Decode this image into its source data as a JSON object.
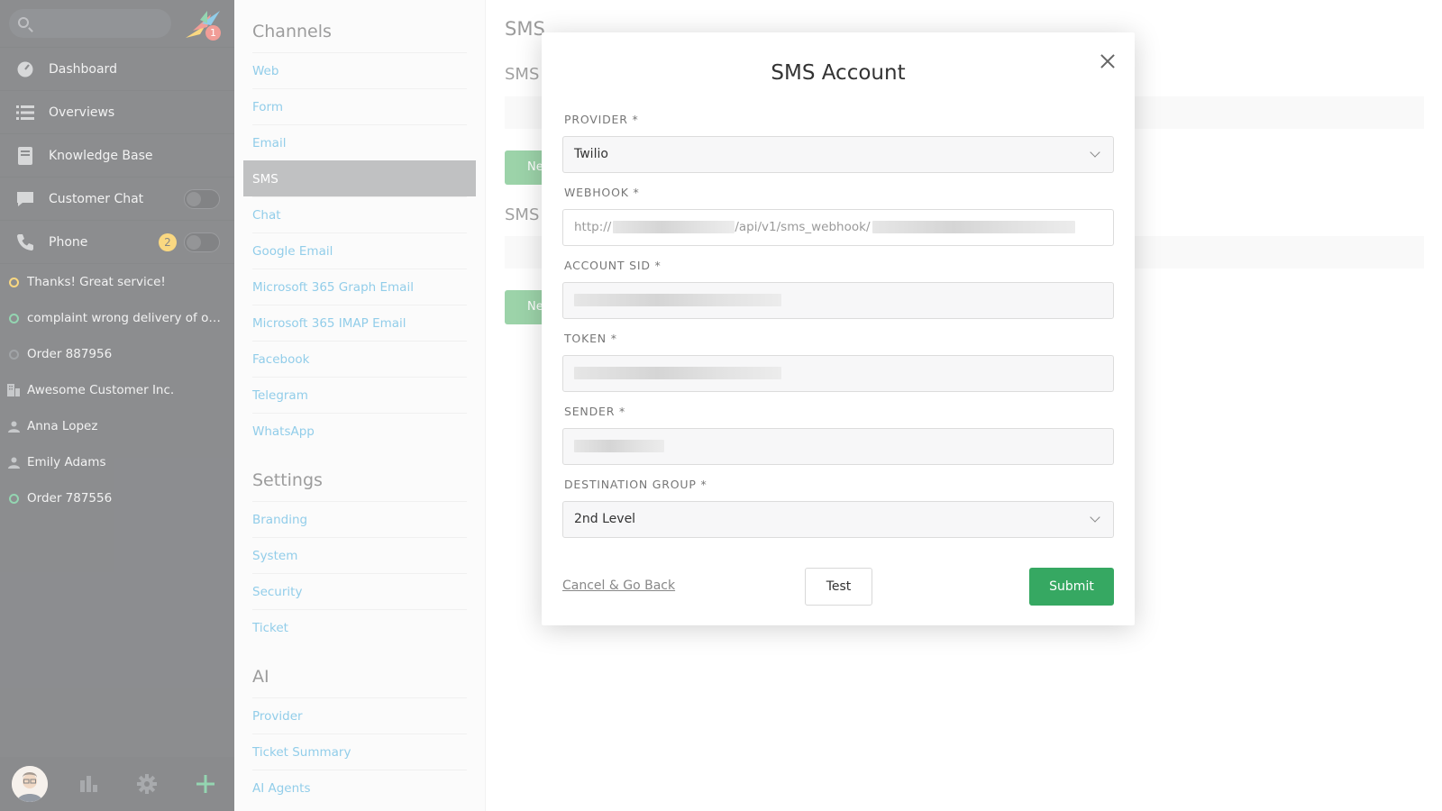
{
  "nav": {
    "notification_count": "1",
    "menu": [
      {
        "label": "Dashboard",
        "icon": "dashboard-icon"
      },
      {
        "label": "Overviews",
        "icon": "list-icon"
      },
      {
        "label": "Knowledge Base",
        "icon": "book-icon"
      },
      {
        "label": "Customer Chat",
        "icon": "chat-icon"
      },
      {
        "label": "Phone",
        "icon": "phone-icon",
        "badge": "2"
      }
    ],
    "tasks": [
      {
        "label": "Thanks! Great service!",
        "type": "ticket",
        "status_color": "#f6b91b"
      },
      {
        "label": "complaint wrong delivery of ord...",
        "type": "ticket",
        "status_color": "#3cb371"
      },
      {
        "label": "Order 887956",
        "type": "ticket",
        "status_color": "#555a60"
      },
      {
        "label": "Awesome Customer Inc.",
        "type": "organization"
      },
      {
        "label": "Anna Lopez",
        "type": "user"
      },
      {
        "label": "Emily Adams",
        "type": "user"
      },
      {
        "label": "Order 787556",
        "type": "ticket",
        "status_color": "#3cb371"
      }
    ]
  },
  "settings": {
    "channels_title": "Channels",
    "channels": [
      "Web",
      "Form",
      "Email",
      "SMS",
      "Chat",
      "Google Email",
      "Microsoft 365 Graph Email",
      "Microsoft 365 IMAP Email",
      "Facebook",
      "Telegram",
      "WhatsApp"
    ],
    "active_channel": "SMS",
    "settings_title": "Settings",
    "settings_items": [
      "Branding",
      "System",
      "Security",
      "Ticket"
    ],
    "ai_title": "AI",
    "ai_items": [
      "Provider",
      "Ticket Summary",
      "AI Agents"
    ]
  },
  "main": {
    "title": "SMS",
    "sub1": "SMS",
    "sub2": "SMS",
    "btn1": "Ne",
    "btn2": "Ne"
  },
  "modal": {
    "title": "SMS Account",
    "provider_label": "PROVIDER *",
    "provider_value": "Twilio",
    "webhook_label": "WEBHOOK *",
    "webhook_prefix": "http://",
    "webhook_mid": "/api/v1/sms_webhook/",
    "account_sid_label": "ACCOUNT SID *",
    "token_label": "TOKEN *",
    "sender_label": "SENDER *",
    "destination_group_label": "DESTINATION GROUP *",
    "destination_group_value": "2nd Level",
    "cancel_label": "Cancel & Go Back",
    "test_label": "Test",
    "submit_label": "Submit"
  },
  "colors": {
    "nav_bg": "#2e3034",
    "link": "#38a4d8",
    "active_item": "#8c8e91",
    "submit": "#36a862",
    "badge_yellow": "#f6b91b"
  }
}
